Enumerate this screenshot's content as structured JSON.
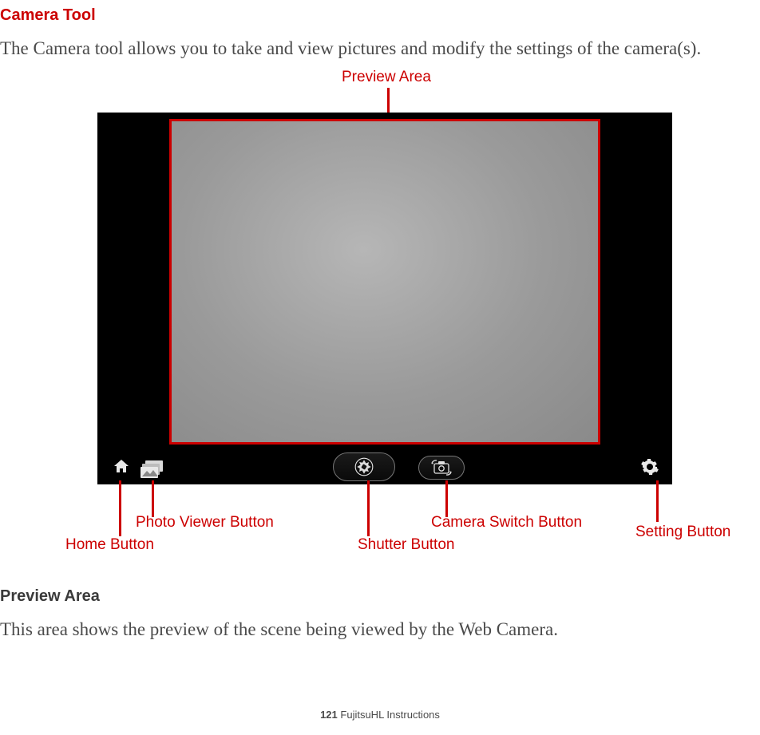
{
  "heading": "Camera Tool",
  "introText": "The Camera tool allows you to take and view pictures and modify the settings of the camera(s).",
  "subheading": "Preview Area",
  "subText": "This area shows the preview of the scene being viewed by the Web Camera.",
  "footer": {
    "pageNumber": "121",
    "label": " FujitsuHL Instructions"
  },
  "callouts": {
    "previewArea": "Preview Area",
    "homeButton": "Home Button",
    "photoViewerButton": "Photo Viewer Button",
    "shutterButton": "Shutter Button",
    "cameraSwitchButton": "Camera Switch Button",
    "settingButton": "Setting Button"
  }
}
